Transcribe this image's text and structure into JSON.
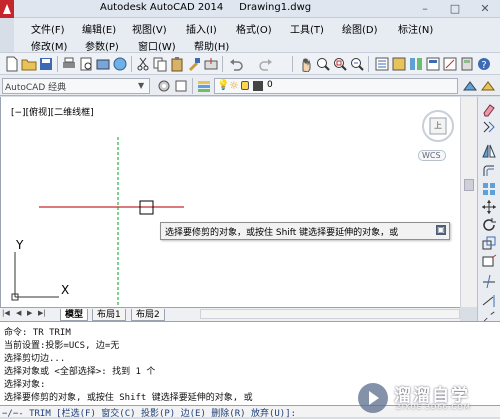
{
  "titlebar": {
    "title": "Autodesk AutoCAD 2014     Drawing1.dwg",
    "minimize": "–",
    "maximize": "□",
    "close": "✕"
  },
  "menu": {
    "row1": [
      "文件(F)",
      "编辑(E)",
      "视图(V)",
      "插入(I)",
      "格式(O)",
      "工具(T)",
      "绘图(D)",
      "标注(N)"
    ],
    "row2": [
      "修改(M)",
      "参数(P)",
      "窗口(W)",
      "帮助(H)"
    ]
  },
  "toolbar2": {
    "workspace": "AutoCAD 经典",
    "layer_value": "0"
  },
  "viewport": {
    "label": "[−][俯视][二维线框]",
    "viewcube_letter": "上",
    "wcs_label": "WCS",
    "ucs_y": "Y",
    "ucs_x": "X"
  },
  "tooltip": {
    "text": "选择要修剪的对象，或按住 Shift 键选择要延伸的对象，或",
    "more_icon": "▣"
  },
  "tabs": {
    "nav": [
      "|◀",
      "◀",
      "▶",
      "▶|"
    ],
    "items": [
      "模型",
      "布局1",
      "布局2"
    ]
  },
  "command": {
    "lines": [
      "命令: TR TRIM",
      "当前设置:投影=UCS, 边=无",
      "选择剪切边...",
      "选择对象或 <全部选择>: 找到 1 个",
      "选择对象:",
      "选择要修剪的对象, 或按住 Shift 键选择要延伸的对象, 或"
    ],
    "input": "−/−- TRIM [栏选(F) 窗交(C) 投影(P) 边(E) 删除(R) 放弃(U)]:"
  },
  "watermark": {
    "name": "溜溜自学",
    "url": "ZIXUE.3D66.COM"
  },
  "colors": {
    "red_line": "#c42b2b",
    "green_line": "#27b34a",
    "brand": "#c6252b"
  }
}
